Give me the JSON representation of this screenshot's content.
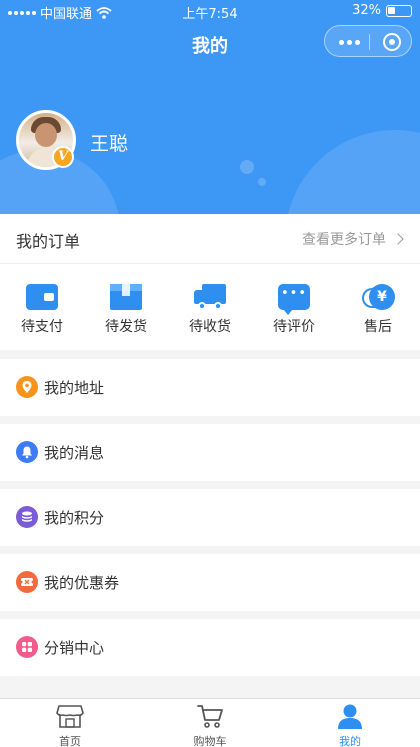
{
  "status_bar": {
    "carrier": "中国联通",
    "time": "上午7:54",
    "battery": "32%"
  },
  "nav": {
    "title": "我的"
  },
  "profile": {
    "username": "王聪",
    "badge": "V"
  },
  "orders": {
    "title": "我的订单",
    "more_label": "查看更多订单",
    "items": [
      {
        "label": "待支付",
        "icon": "wallet-icon"
      },
      {
        "label": "待发货",
        "icon": "package-icon"
      },
      {
        "label": "待收货",
        "icon": "truck-icon"
      },
      {
        "label": "待评价",
        "icon": "comment-icon"
      },
      {
        "label": "售后",
        "icon": "refund-icon",
        "symbol": "¥"
      }
    ]
  },
  "menu": [
    {
      "label": "我的地址",
      "icon": "location-icon",
      "color": "#f7941d"
    },
    {
      "label": "我的消息",
      "icon": "bell-icon",
      "color": "#3d7cf5"
    },
    {
      "label": "我的积分",
      "icon": "coins-icon",
      "color": "#7b5cd6"
    },
    {
      "label": "我的优惠券",
      "icon": "coupon-icon",
      "color": "#f26a3d"
    },
    {
      "label": "分销中心",
      "icon": "grid-icon",
      "color": "#f25c8c"
    }
  ],
  "tabbar": {
    "items": [
      {
        "label": "首页",
        "icon": "shop-icon",
        "active": false
      },
      {
        "label": "购物车",
        "icon": "cart-icon",
        "active": false
      },
      {
        "label": "我的",
        "icon": "user-icon",
        "active": true
      }
    ]
  },
  "colors": {
    "primary": "#3d97f5",
    "accent_blue": "#2f8ff1",
    "badge_orange": "#f5a623"
  }
}
